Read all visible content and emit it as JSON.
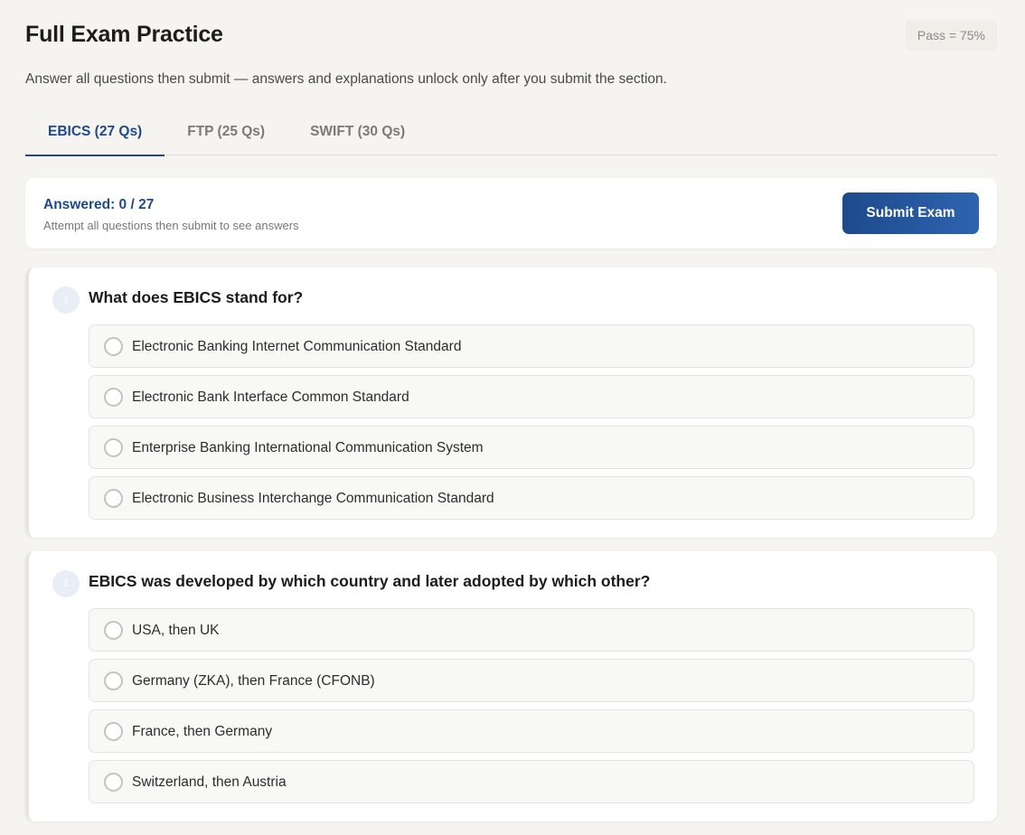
{
  "header": {
    "title": "Full Exam Practice",
    "pass_badge": "Pass = 75%",
    "subtitle": "Answer all questions then submit — answers and explanations unlock only after you submit the section."
  },
  "tabs": [
    {
      "label": "EBICS (27 Qs)",
      "active": true
    },
    {
      "label": "FTP (25 Qs)",
      "active": false
    },
    {
      "label": "SWIFT (30 Qs)",
      "active": false
    }
  ],
  "status": {
    "answered": "Answered: 0 / 27",
    "hint": "Attempt all questions then submit to see answers",
    "submit_label": "Submit Exam"
  },
  "questions": [
    {
      "number": "1",
      "text": "What does EBICS stand for?",
      "options": [
        "Electronic Banking Internet Communication Standard",
        "Electronic Bank Interface Common Standard",
        "Enterprise Banking International Communication System",
        "Electronic Business Interchange Communication Standard"
      ]
    },
    {
      "number": "2",
      "text": "EBICS was developed by which country and later adopted by which other?",
      "options": [
        "USA, then UK",
        "Germany (ZKA), then France (CFONB)",
        "France, then Germany",
        "Switzerland, then Austria"
      ]
    }
  ],
  "colors": {
    "accent": "#1e4a8a",
    "background": "#f5f4f1",
    "card": "#ffffff"
  }
}
